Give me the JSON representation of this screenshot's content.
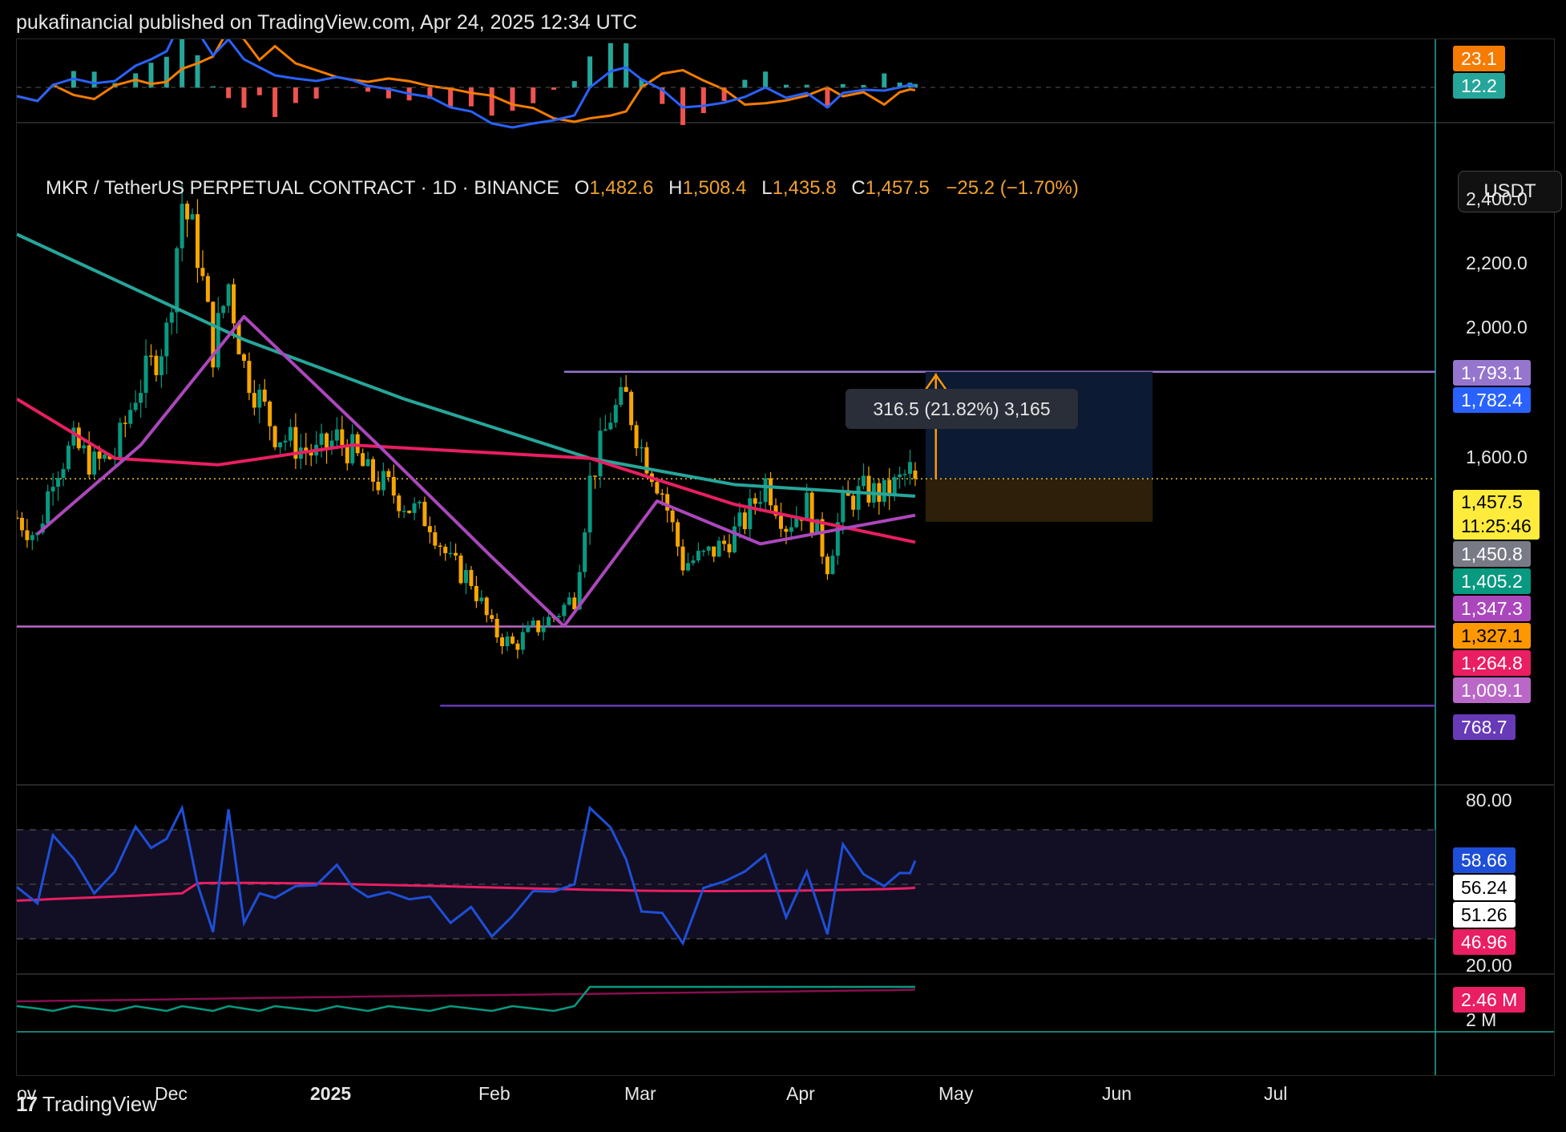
{
  "header": {
    "published": "pukafinancial published on TradingView.com, Apr 24, 2025 12:34 UTC"
  },
  "footer": {
    "brand": "TradingView",
    "logo_glyph": "17"
  },
  "legend": {
    "symbol": "MKR / TetherUS PERPETUAL CONTRACT · 1D · BINANCE",
    "o_label": "O",
    "o": "1,482.6",
    "h_label": "H",
    "h": "1,508.4",
    "l_label": "L",
    "l": "1,435.8",
    "c_label": "C",
    "c": "1,457.5",
    "change": "−25.2 (−1.70%)"
  },
  "unit": "USDT",
  "measure": {
    "label": "316.5 (21.82%) 3,165"
  },
  "price_axis_ticks": [
    "2,400.0",
    "2,200.0",
    "2,000.0",
    "1,600.0"
  ],
  "price_tags": [
    {
      "text": "1,793.1",
      "bg": "#9575cd"
    },
    {
      "text": "1,782.4",
      "bg": "#2962ff"
    },
    {
      "text": "1,457.5",
      "sub": "11:25:46",
      "bg": "#ffeb3b",
      "fg": "#000000"
    },
    {
      "text": "1,450.8",
      "bg": "#787b86"
    },
    {
      "text": "1,405.2",
      "bg": "#089981"
    },
    {
      "text": "1,347.3",
      "bg": "#ab47bc"
    },
    {
      "text": "1,327.1",
      "bg": "#ff9800",
      "fg": "#000000"
    },
    {
      "text": "1,264.8",
      "bg": "#e91e63"
    },
    {
      "text": "1,009.1",
      "bg": "#ba68c8"
    },
    {
      "text": "768.7",
      "bg": "#673ab7"
    }
  ],
  "macd_tags": [
    {
      "text": "23.1",
      "bg": "#f57c00"
    },
    {
      "text": "12.2",
      "bg": "#26a69a"
    }
  ],
  "rsi_axis": [
    "80.00",
    "20.00"
  ],
  "rsi_tags": [
    {
      "text": "58.66",
      "bg": "#1e4fd8"
    },
    {
      "text": "56.24",
      "bg": "#ffffff",
      "fg": "#000000"
    },
    {
      "text": "51.26",
      "bg": "#ffffff",
      "fg": "#000000"
    },
    {
      "text": "46.96",
      "bg": "#e91e63"
    }
  ],
  "volume_tags": [
    {
      "text": "2.46 M",
      "bg": "#e91e63"
    }
  ],
  "volume_axis": [
    "2 M"
  ],
  "x_axis_labels": [
    "ov",
    "Dec",
    "2025",
    "Feb",
    "Mar",
    "Apr",
    "May",
    "Jun",
    "Jul"
  ],
  "chart_data": {
    "type": "candlestick",
    "symbol": "MKR / TetherUS PERPETUAL CONTRACT",
    "timeframe": "1D",
    "exchange": "BINANCE",
    "ylim": [
      650,
      2500
    ],
    "x_range": [
      "2024-11-01",
      "2025-07-31"
    ],
    "last": {
      "open": 1482.6,
      "high": 1508.4,
      "low": 1435.8,
      "close": 1457.5,
      "change": -25.2,
      "change_pct": -1.7
    },
    "closes_approx": [
      {
        "date": "2024-11-01",
        "close": 1340
      },
      {
        "date": "2024-11-05",
        "close": 1280
      },
      {
        "date": "2024-11-08",
        "close": 1480
      },
      {
        "date": "2024-11-12",
        "close": 1560
      },
      {
        "date": "2024-11-16",
        "close": 1500
      },
      {
        "date": "2024-11-20",
        "close": 1530
      },
      {
        "date": "2024-11-24",
        "close": 1720
      },
      {
        "date": "2024-11-27",
        "close": 1800
      },
      {
        "date": "2024-11-30",
        "close": 1900
      },
      {
        "date": "2024-12-03",
        "close": 2300
      },
      {
        "date": "2024-12-06",
        "close": 2150
      },
      {
        "date": "2024-12-09",
        "close": 1850
      },
      {
        "date": "2024-12-12",
        "close": 2050
      },
      {
        "date": "2024-12-15",
        "close": 1800
      },
      {
        "date": "2024-12-18",
        "close": 1700
      },
      {
        "date": "2024-12-21",
        "close": 1600
      },
      {
        "date": "2024-12-25",
        "close": 1560
      },
      {
        "date": "2024-12-29",
        "close": 1530
      },
      {
        "date": "2025-01-02",
        "close": 1580
      },
      {
        "date": "2025-01-05",
        "close": 1540
      },
      {
        "date": "2025-01-08",
        "close": 1470
      },
      {
        "date": "2025-01-12",
        "close": 1430
      },
      {
        "date": "2025-01-16",
        "close": 1370
      },
      {
        "date": "2025-01-20",
        "close": 1330
      },
      {
        "date": "2025-01-24",
        "close": 1200
      },
      {
        "date": "2025-01-28",
        "close": 1150
      },
      {
        "date": "2025-02-01",
        "close": 1000
      },
      {
        "date": "2025-02-05",
        "close": 950
      },
      {
        "date": "2025-02-09",
        "close": 1000
      },
      {
        "date": "2025-02-13",
        "close": 1040
      },
      {
        "date": "2025-02-17",
        "close": 1100
      },
      {
        "date": "2025-02-20",
        "close": 1450
      },
      {
        "date": "2025-02-24",
        "close": 1650
      },
      {
        "date": "2025-02-27",
        "close": 1700
      },
      {
        "date": "2025-03-02",
        "close": 1550
      },
      {
        "date": "2025-03-06",
        "close": 1420
      },
      {
        "date": "2025-03-10",
        "close": 1200
      },
      {
        "date": "2025-03-14",
        "close": 1220
      },
      {
        "date": "2025-03-18",
        "close": 1260
      },
      {
        "date": "2025-03-22",
        "close": 1330
      },
      {
        "date": "2025-03-26",
        "close": 1450
      },
      {
        "date": "2025-03-30",
        "close": 1320
      },
      {
        "date": "2025-04-03",
        "close": 1380
      },
      {
        "date": "2025-04-07",
        "close": 1200
      },
      {
        "date": "2025-04-10",
        "close": 1380
      },
      {
        "date": "2025-04-14",
        "close": 1420
      },
      {
        "date": "2025-04-18",
        "close": 1410
      },
      {
        "date": "2025-04-21",
        "close": 1450
      },
      {
        "date": "2025-04-23",
        "close": 1482.6
      },
      {
        "date": "2025-04-24",
        "close": 1457.5
      }
    ],
    "moving_averages": [
      {
        "color": "#26a69a",
        "approx": [
          [
            "2024-11-01",
            2200
          ],
          [
            "2024-12-15",
            1880
          ],
          [
            "2025-01-15",
            1700
          ],
          [
            "2025-02-20",
            1520
          ],
          [
            "2025-03-20",
            1440
          ],
          [
            "2025-04-24",
            1405
          ]
        ]
      },
      {
        "color": "#e91e63",
        "approx": [
          [
            "2024-11-01",
            1700
          ],
          [
            "2024-11-20",
            1520
          ],
          [
            "2024-12-10",
            1500
          ],
          [
            "2025-01-05",
            1560
          ],
          [
            "2025-02-20",
            1520
          ],
          [
            "2025-03-20",
            1380
          ],
          [
            "2025-04-24",
            1265
          ]
        ]
      },
      {
        "color": "#ab47bc",
        "approx": [
          [
            "2024-11-05",
            1290
          ],
          [
            "2024-11-25",
            1560
          ],
          [
            "2024-12-15",
            1950
          ],
          [
            "2025-01-10",
            1560
          ],
          [
            "2025-02-01",
            1220
          ],
          [
            "2025-02-15",
            1010
          ],
          [
            "2025-03-05",
            1390
          ],
          [
            "2025-03-25",
            1260
          ],
          [
            "2025-04-24",
            1347
          ]
        ]
      }
    ],
    "horizontal_levels": [
      1782.4,
      1793.1,
      1009.1,
      768.7
    ],
    "position_tool": {
      "entry": 1457.5,
      "target": 1782.4,
      "stop": 1327.1,
      "label": "316.5 (21.82%) 3,165"
    },
    "rsi": {
      "value": 58.66,
      "ma": 51.26,
      "levels": [
        70,
        50,
        30
      ],
      "axis": [
        80,
        20
      ]
    },
    "macd": {
      "macd": 23.1,
      "signal": 12.2
    },
    "volume": {
      "ma": "2.46 M"
    }
  }
}
